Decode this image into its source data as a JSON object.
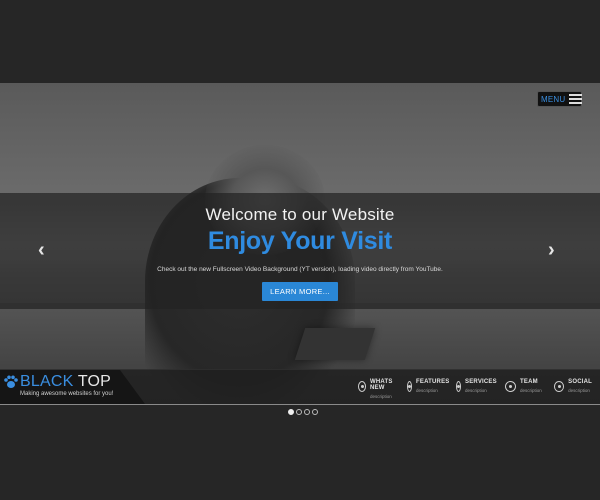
{
  "menu": {
    "label": "MENU"
  },
  "slide": {
    "welcome": "Welcome to our Website",
    "headline": "Enjoy Your Visit",
    "description": "Check out the new Fullscreen Video Background (YT version), loading video directly from YouTube.",
    "button_label": "LEARN MORE..."
  },
  "brand": {
    "name_part1": "BLACK",
    "name_part2": " TOP",
    "tagline": "Making awesome websites for you!"
  },
  "nav": [
    {
      "title": "WHATS NEW",
      "sub": "description",
      "icon": "eye-icon"
    },
    {
      "title": "FEATURES",
      "sub": "description",
      "icon": "eye-icon"
    },
    {
      "title": "SERVICES",
      "sub": "description",
      "icon": "eye-icon"
    },
    {
      "title": "TEAM",
      "sub": "description",
      "icon": "eye-icon"
    },
    {
      "title": "SOCIAL",
      "sub": "description",
      "icon": "eye-icon"
    }
  ],
  "slider": {
    "slide_count": 4,
    "active_slide": 1
  },
  "colors": {
    "accent": "#2f8be0",
    "band": "#232323",
    "background": "#262626"
  }
}
